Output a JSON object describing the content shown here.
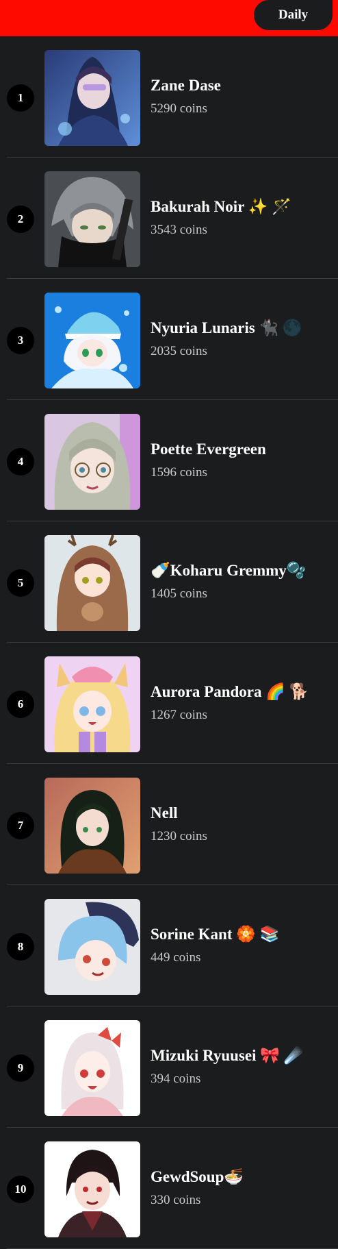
{
  "header": {
    "period_label": "Daily"
  },
  "colors": {
    "accent": "#ff0a00",
    "background": "#1b1c1e"
  },
  "leaderboard": [
    {
      "rank": "1",
      "name": "Zane Dase",
      "coins": "5290 coins",
      "avatar": "avatar-hooded-purple-hair"
    },
    {
      "rank": "2",
      "name": "Bakurah Noir ✨ 🪄",
      "coins": "3543 coins",
      "avatar": "avatar-grey-hair-masked"
    },
    {
      "rank": "3",
      "name": "Nyuria Lunaris 🐈‍⬛ 🌑",
      "coins": "2035 coins",
      "avatar": "avatar-white-hair-blue-hat"
    },
    {
      "rank": "4",
      "name": "Poette Evergreen",
      "coins": "1596 coins",
      "avatar": "avatar-glasses-silver-hair"
    },
    {
      "rank": "5",
      "name": "🍼Koharu Gremmy🫧",
      "coins": "1405 coins",
      "avatar": "avatar-reindeer-hood"
    },
    {
      "rank": "6",
      "name": "Aurora Pandora 🌈 🐕",
      "coins": "1267 coins",
      "avatar": "avatar-blonde-cat-ears"
    },
    {
      "rank": "7",
      "name": "Nell",
      "coins": "1230 coins",
      "avatar": "avatar-dark-green-hair"
    },
    {
      "rank": "8",
      "name": "Sorine Kant 🏵️ 📚",
      "coins": "449 coins",
      "avatar": "avatar-blue-hair-beret"
    },
    {
      "rank": "9",
      "name": "Mizuki Ryuusei 🎀 ☄️",
      "coins": "394 coins",
      "avatar": "avatar-pink-hair-bow"
    },
    {
      "rank": "10",
      "name": "GewdSoup🍜",
      "coins": "330 coins",
      "avatar": "avatar-dark-hair-red-eyes"
    }
  ]
}
